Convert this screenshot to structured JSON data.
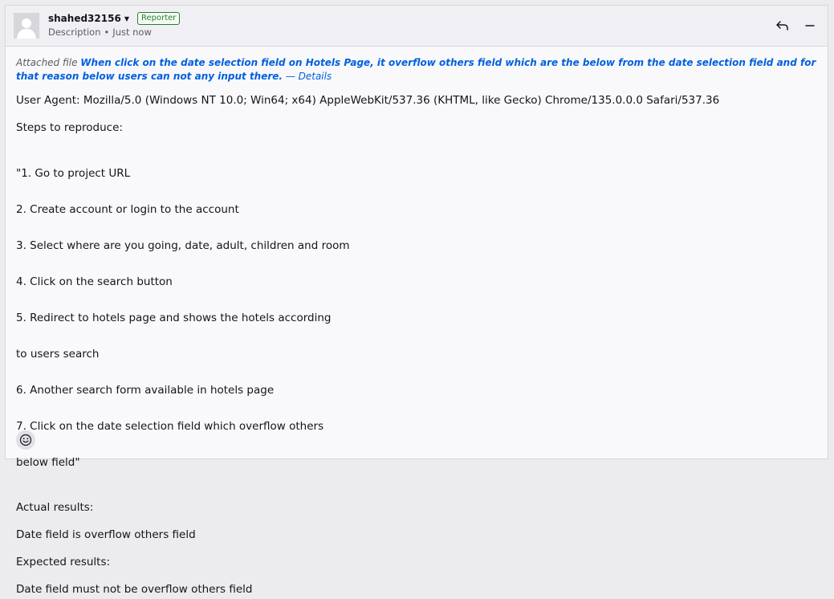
{
  "author": {
    "name": "shahed32156",
    "role": "Reporter",
    "meta_kind": "Description",
    "meta_separator": "•",
    "meta_time": "Just now"
  },
  "icons": {
    "avatar": "default-user-icon",
    "author_menu": "caret-down-icon",
    "reply": "reply-icon",
    "collapse": "minus-icon",
    "reaction": "smiley-icon"
  },
  "colors": {
    "link": "#0060df",
    "reporter_badge": "#2a7d2e",
    "header_bg": "#f0f0f4"
  },
  "attachment": {
    "prefix": "Attached file",
    "title": "When click on the date selection field on Hotels Page, it overflow others field which are the below from the date selection field and for that reason below users can not any input there.",
    "details": "— Details"
  },
  "body": {
    "user_agent": "User Agent: Mozilla/5.0 (Windows NT 10.0; Win64; x64) AppleWebKit/537.36 (KHTML, like Gecko) Chrome/135.0.0.0 Safari/537.36",
    "steps_heading": "Steps to reproduce:",
    "steps": [
      "\"1. Go to project URL",
      "2. Create account or login to the account",
      "3. Select where are you going, date, adult, children and room",
      "4. Click on the search button",
      "5. Redirect to hotels page and shows the hotels according",
      "to users search",
      "6. Another search form available in hotels page",
      "7. Click on the date selection field which overflow others",
      "below field\""
    ],
    "actual_heading": "Actual results:",
    "actual": "Date field is overflow others field",
    "expected_heading": "Expected results:",
    "expected": "Date field must not be overflow others field"
  }
}
